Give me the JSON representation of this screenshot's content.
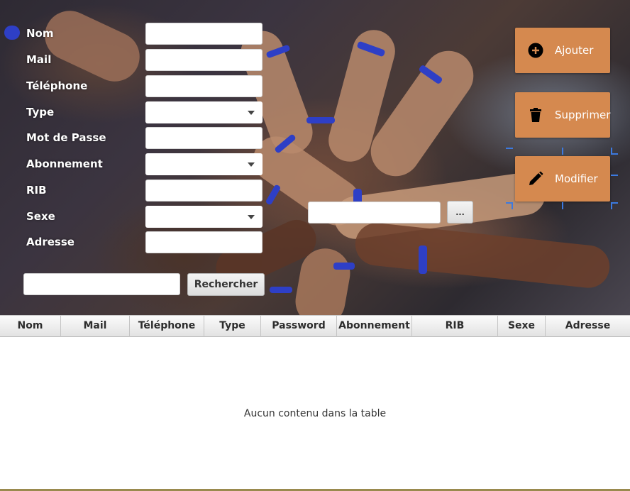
{
  "form": {
    "labels": {
      "nom": "Nom",
      "mail": "Mail",
      "telephone": "Téléphone",
      "type": "Type",
      "mot_de_passe": "Mot de Passe",
      "abonnement": "Abonnement",
      "rib": "RIB",
      "sexe": "Sexe",
      "adresse": "Adresse"
    },
    "values": {
      "nom": "",
      "mail": "",
      "telephone": "",
      "type": "",
      "mot_de_passe": "",
      "abonnement": "",
      "rib": "",
      "sexe": "",
      "adresse": ""
    }
  },
  "search": {
    "value": "",
    "button_label": "Rechercher"
  },
  "file": {
    "value": "",
    "browse_label": "..."
  },
  "actions": {
    "add": {
      "label": "Ajouter",
      "icon": "plus-circle-icon"
    },
    "delete": {
      "label": "Supprimer",
      "icon": "trash-icon"
    },
    "edit": {
      "label": "Modifier",
      "icon": "pencil-icon"
    },
    "color": "#d5894f"
  },
  "table": {
    "columns": [
      "Nom",
      "Mail",
      "Téléphone",
      "Type",
      "Password",
      "Abonnement",
      "RIB",
      "Sexe",
      "Adresse"
    ],
    "empty_message": "Aucun contenu dans la table"
  }
}
